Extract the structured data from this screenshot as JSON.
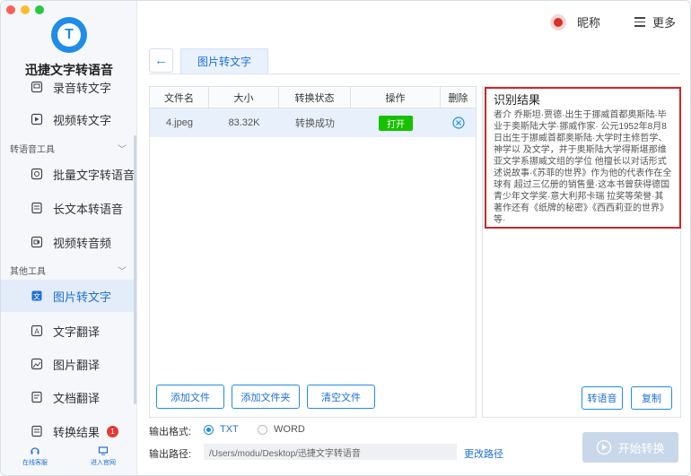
{
  "app": {
    "title": "迅捷文字转语音"
  },
  "sidebar": {
    "items_top": [
      {
        "label": "录音转文字",
        "icon": "mic-doc-icon"
      },
      {
        "label": "视频转文字",
        "icon": "video-doc-icon"
      }
    ],
    "section1": {
      "label": "转语音工具"
    },
    "items_mid": [
      {
        "label": "批量文字转语音",
        "icon": "batch-doc-icon"
      },
      {
        "label": "长文本转语音",
        "icon": "long-text-icon"
      },
      {
        "label": "视频转音频",
        "icon": "video-audio-icon"
      }
    ],
    "section2": {
      "label": "其他工具"
    },
    "items_bot": [
      {
        "label": "图片转文字",
        "icon": "image-text-icon",
        "active": true
      },
      {
        "label": "文字翻译",
        "icon": "translate-icon"
      },
      {
        "label": "图片翻译",
        "icon": "image-translate-icon"
      },
      {
        "label": "文档翻译",
        "icon": "doc-translate-icon"
      },
      {
        "label": "转换结果",
        "icon": "result-icon",
        "badge": "1"
      }
    ],
    "bottom_links": [
      {
        "label": "在线客服",
        "icon": "headset-icon"
      },
      {
        "label": "进入官网",
        "icon": "monitor-icon"
      }
    ]
  },
  "header": {
    "nickname": "昵称",
    "more": "更多"
  },
  "tabs": {
    "active": "图片转文字"
  },
  "table": {
    "headers": [
      "文件名",
      "大小",
      "转换状态",
      "操作",
      "删除"
    ],
    "rows": [
      {
        "name": "4.jpeg",
        "size": "83.32K",
        "status": "转换成功",
        "action": "打开"
      }
    ]
  },
  "buttons": {
    "add_file": "添加文件",
    "add_folder": "添加文件夹",
    "clear": "清空文件"
  },
  "result": {
    "title": "识别结果",
    "text": "者介 乔斯坦·贾德·出生于挪威首都奥斯陆·毕业于奥斯陆大学·挪威作家· 公元1952年8月8日出生于挪威首都奥斯陆·大学时主修哲学、神学以 及文学，并于奥斯陆大学得斯堪那维亚文学系挪威文组的学位 他擅长以对话形式述说故事·《苏菲的世界》作为他的代表作在全球有 超过三亿册的销售量·这本书曾获得德国青少年文学奖·意大利邦卡瑞 拉奖等荣誉·其著作还有《纸牌的秘密》《西西莉亚的世界》等·",
    "to_speech": "转语音",
    "copy": "复制"
  },
  "output": {
    "format_label": "输出格式:",
    "format_txt": "TXT",
    "format_word": "WORD",
    "path_label": "输出路径:",
    "path_value": "/Users/modu/Desktop/迅捷文字转语音",
    "change_path": "更改路径",
    "start": "开始转换"
  },
  "colors": {
    "accent": "#1f8ce6",
    "open_button": "#16c100",
    "highlight_border": "#c62828",
    "badge": "#e53935"
  }
}
